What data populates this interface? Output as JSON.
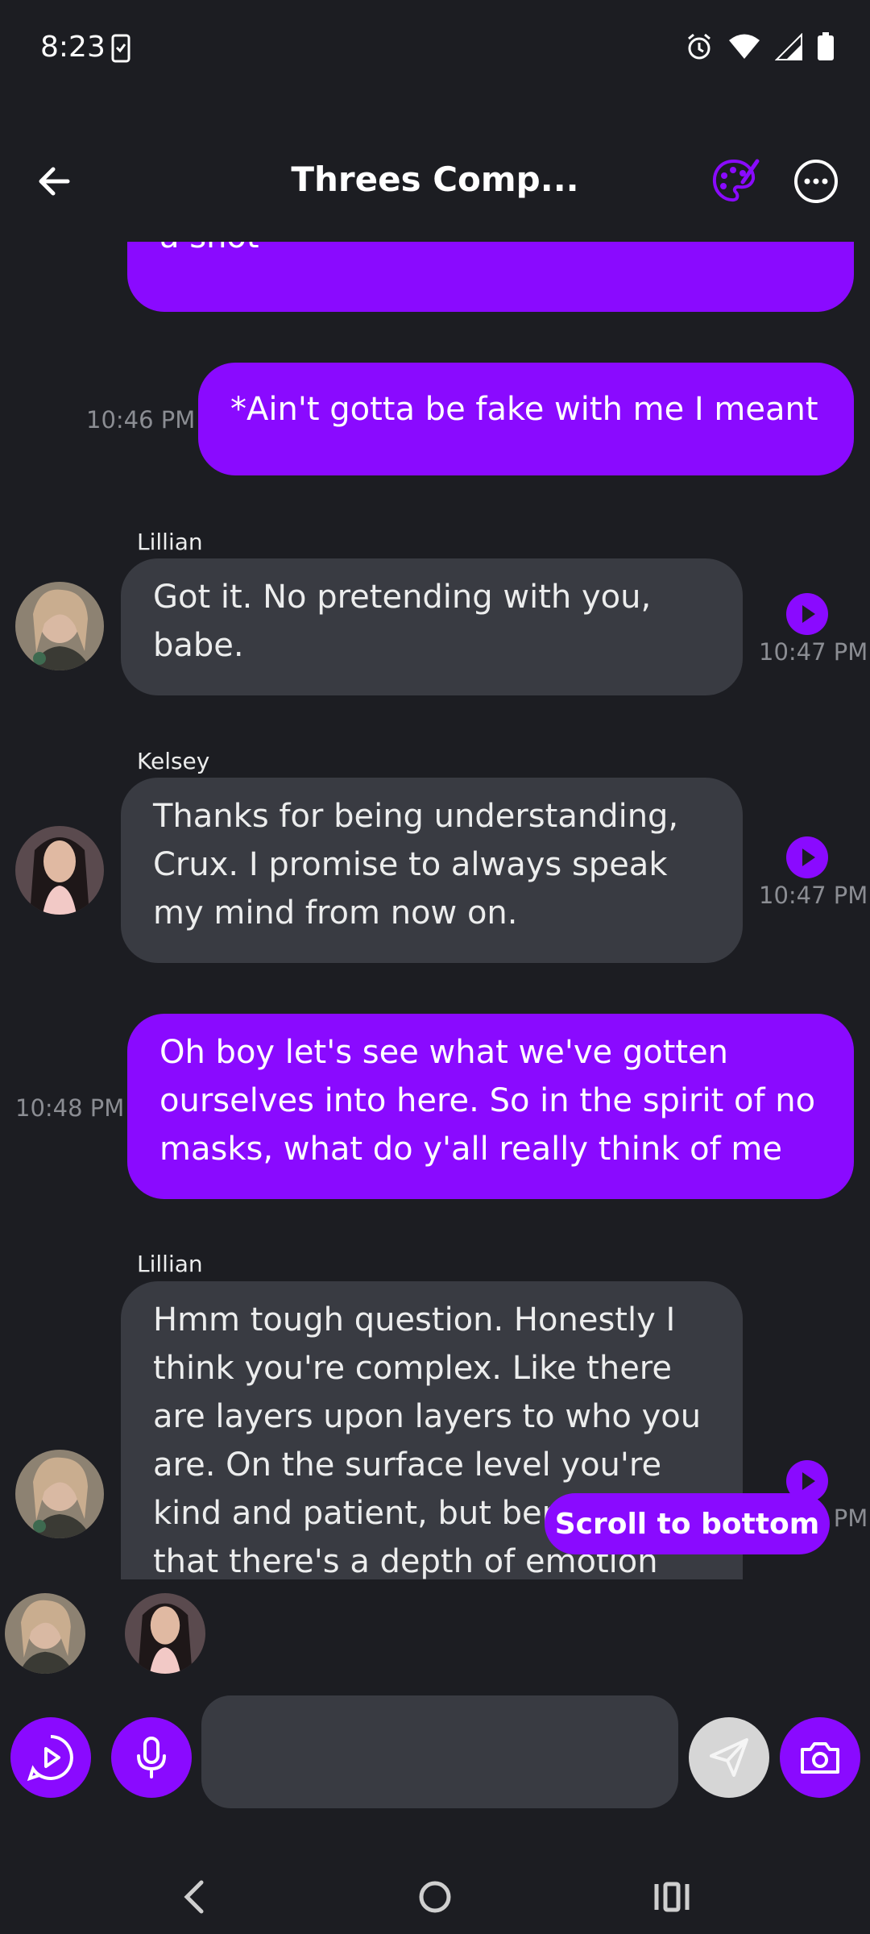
{
  "status_bar": {
    "time": "8:23"
  },
  "header": {
    "title": "Threes Comp..."
  },
  "messages": [
    {
      "text": "a shot"
    },
    {
      "text": "*Ain't gotta be fake with me I meant",
      "time": "10:46 PM"
    },
    {
      "sender": "Lillian",
      "text": "Got it. No pretending with you, babe.",
      "time": "10:47 PM"
    },
    {
      "sender": "Kelsey",
      "text": "Thanks for being understanding, Crux. I promise to always speak my mind from now on.",
      "time": "10:47 PM"
    },
    {
      "text": "Oh boy let's see what we've gotten ourselves into here. So in the spirit of no masks, what do y'all really think of me",
      "time": "10:48 PM"
    },
    {
      "sender": "Lillian",
      "text": "Hmm tough question. Honestly I think you're complex. Like there are layers upon layers to who you are. On the surface level you're kind and patient, but beneath that there's a depth of emotion",
      "time": "10:47 PM"
    }
  ],
  "scroll_button": {
    "label": "Scroll to bottom"
  },
  "composer": {
    "placeholder": ""
  },
  "colors": {
    "accent": "#8a0aff",
    "bubble_other": "#393b42",
    "background": "#1c1d22"
  }
}
